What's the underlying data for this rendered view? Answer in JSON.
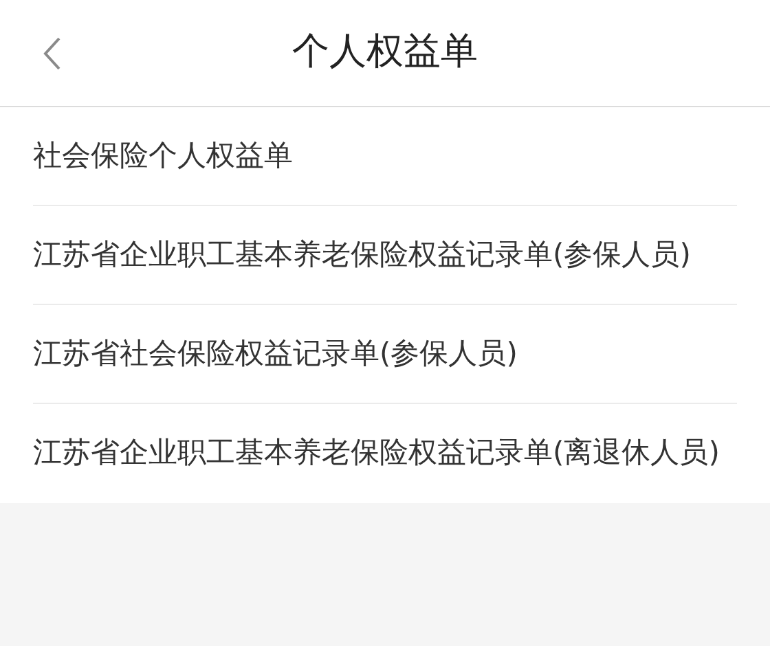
{
  "header": {
    "title": "个人权益单"
  },
  "items": [
    {
      "label": "社会保险个人权益单"
    },
    {
      "label": "江苏省企业职工基本养老保险权益记录单(参保人员)"
    },
    {
      "label": "江苏省社会保险权益记录单(参保人员)"
    },
    {
      "label": "江苏省企业职工基本养老保险权益记录单(离退休人员)"
    }
  ]
}
